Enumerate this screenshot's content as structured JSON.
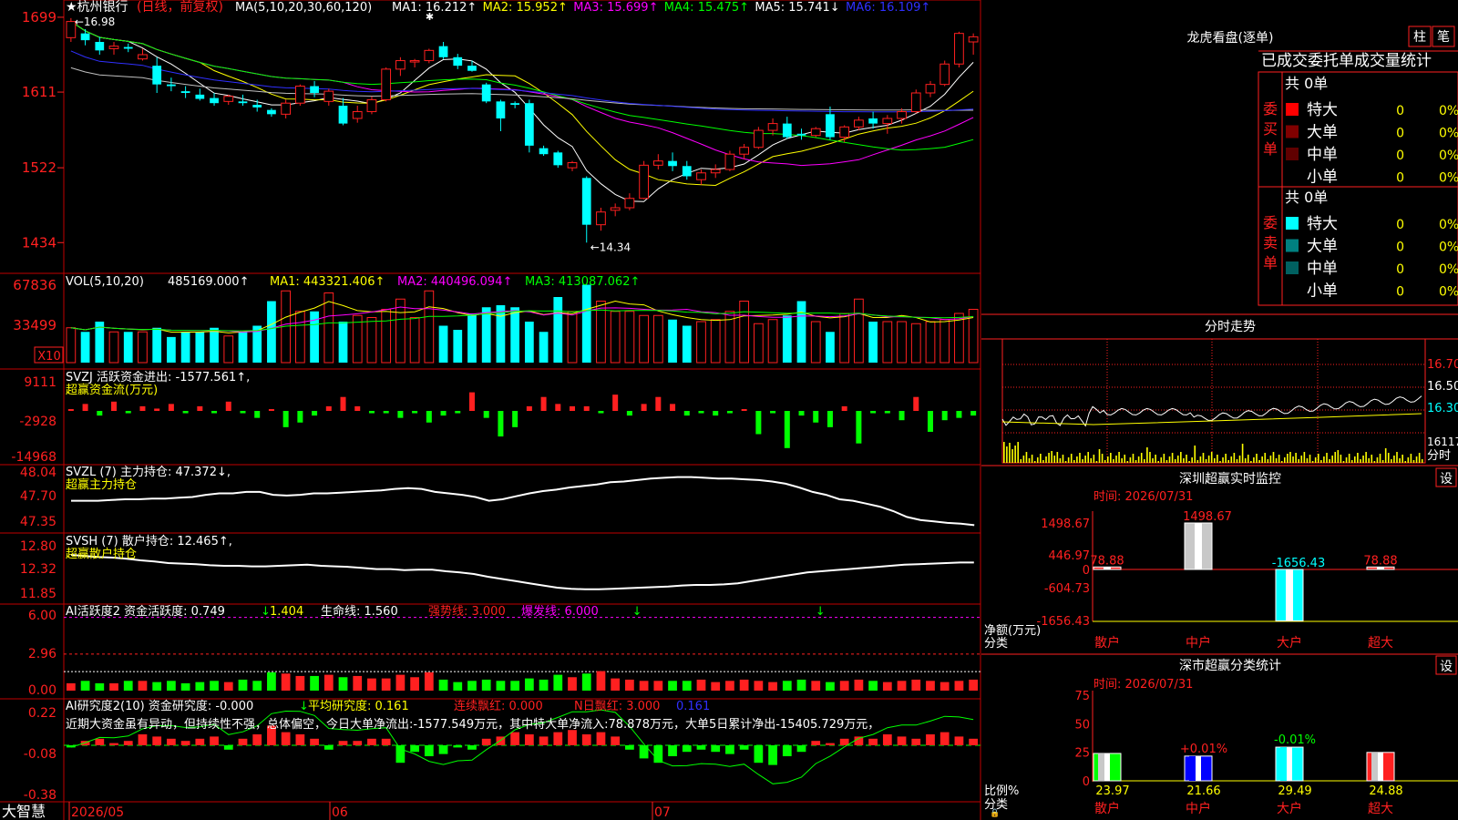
{
  "colors": {
    "up": "#ff2020",
    "down": "#00ffff",
    "border": "#c00000",
    "ma1": "#ffffff",
    "ma2": "#ffff00",
    "ma3": "#ff00ff",
    "ma4": "#00ff00",
    "ma5": "#c0c0c0",
    "ma6": "#3030ff",
    "green_bar": "#00ff00"
  },
  "title_bar": {
    "star": "★",
    "stock_name": "杭州银行",
    "period": "(日线，前复权)",
    "ma_params": "MA(5,10,20,30,60,120)",
    "ma_values": [
      {
        "label": "MA1: 16.212↑",
        "color": "#ffffff"
      },
      {
        "label": "MA2: 15.952↑",
        "color": "#ffff00"
      },
      {
        "label": "MA3: 15.699↑",
        "color": "#ff00ff"
      },
      {
        "label": "MA4: 15.475↑",
        "color": "#00ff00"
      },
      {
        "label": "MA5: 15.741↓",
        "color": "#ffffff"
      },
      {
        "label": "MA6: 16.109↑",
        "color": "#3030ff"
      }
    ]
  },
  "price_axis": [
    "1699",
    "1611",
    "1522",
    "1434"
  ],
  "high_label": "16.98",
  "low_label": "14.34",
  "candles": [
    [
      16.75,
      16.98,
      16.7,
      16.94
    ],
    [
      16.8,
      16.85,
      16.66,
      16.72
    ],
    [
      16.7,
      16.76,
      16.55,
      16.6
    ],
    [
      16.62,
      16.7,
      16.55,
      16.65
    ],
    [
      16.64,
      16.68,
      16.58,
      16.62
    ],
    [
      16.5,
      16.62,
      16.48,
      16.55
    ],
    [
      16.42,
      16.52,
      16.1,
      16.2
    ],
    [
      16.2,
      16.28,
      16.12,
      16.18
    ],
    [
      16.12,
      16.18,
      16.04,
      16.1
    ],
    [
      16.08,
      16.15,
      16.01,
      16.03
    ],
    [
      16.04,
      16.1,
      15.95,
      15.98
    ],
    [
      16.0,
      16.08,
      15.96,
      16.06
    ],
    [
      16.0,
      16.08,
      15.95,
      15.98
    ],
    [
      15.96,
      16.02,
      15.88,
      15.93
    ],
    [
      15.9,
      15.92,
      15.82,
      15.85
    ],
    [
      15.85,
      16.02,
      15.8,
      15.98
    ],
    [
      15.98,
      16.2,
      15.95,
      16.18
    ],
    [
      16.18,
      16.24,
      16.05,
      16.1
    ],
    [
      16.0,
      16.15,
      15.95,
      16.12
    ],
    [
      15.95,
      16.04,
      15.72,
      15.74
    ],
    [
      15.8,
      15.95,
      15.75,
      15.88
    ],
    [
      15.88,
      16.06,
      15.85,
      16.02
    ],
    [
      16.02,
      16.4,
      16.0,
      16.38
    ],
    [
      16.38,
      16.52,
      16.3,
      16.48
    ],
    [
      16.48,
      16.5,
      16.4,
      16.48
    ],
    [
      16.48,
      16.62,
      16.45,
      16.6
    ],
    [
      16.65,
      16.7,
      16.5,
      16.52
    ],
    [
      16.52,
      16.56,
      16.38,
      16.42
    ],
    [
      16.42,
      16.48,
      16.35,
      16.36
    ],
    [
      16.2,
      16.22,
      15.98,
      16.0
    ],
    [
      16.0,
      16.02,
      15.65,
      15.8
    ],
    [
      15.98,
      16.0,
      15.92,
      15.96
    ],
    [
      15.98,
      16.02,
      15.4,
      15.48
    ],
    [
      15.45,
      15.48,
      15.36,
      15.38
    ],
    [
      15.4,
      15.42,
      15.22,
      15.25
    ],
    [
      15.22,
      15.3,
      15.18,
      15.28
    ],
    [
      15.1,
      15.12,
      14.34,
      14.55
    ],
    [
      14.55,
      14.75,
      14.48,
      14.7
    ],
    [
      14.72,
      14.8,
      14.65,
      14.75
    ],
    [
      14.75,
      14.92,
      14.72,
      14.86
    ],
    [
      14.86,
      15.3,
      14.85,
      15.25
    ],
    [
      15.25,
      15.38,
      15.2,
      15.3
    ],
    [
      15.3,
      15.4,
      15.18,
      15.24
    ],
    [
      15.24,
      15.3,
      15.08,
      15.12
    ],
    [
      15.08,
      15.2,
      15.02,
      15.16
    ],
    [
      15.16,
      15.26,
      15.1,
      15.2
    ],
    [
      15.2,
      15.42,
      15.18,
      15.38
    ],
    [
      15.38,
      15.5,
      15.32,
      15.46
    ],
    [
      15.46,
      15.7,
      15.44,
      15.66
    ],
    [
      15.66,
      15.8,
      15.6,
      15.74
    ],
    [
      15.74,
      15.82,
      15.56,
      15.58
    ],
    [
      15.62,
      15.68,
      15.55,
      15.6
    ],
    [
      15.6,
      15.7,
      15.58,
      15.68
    ],
    [
      15.85,
      15.94,
      15.55,
      15.58
    ],
    [
      15.58,
      15.72,
      15.52,
      15.7
    ],
    [
      15.7,
      15.82,
      15.66,
      15.78
    ],
    [
      15.8,
      15.88,
      15.68,
      15.74
    ],
    [
      15.74,
      15.84,
      15.62,
      15.8
    ],
    [
      15.8,
      15.92,
      15.74,
      15.88
    ],
    [
      15.88,
      16.14,
      15.86,
      16.1
    ],
    [
      16.1,
      16.24,
      16.05,
      16.2
    ],
    [
      16.2,
      16.48,
      16.18,
      16.44
    ],
    [
      16.44,
      16.82,
      16.4,
      16.8
    ],
    [
      16.7,
      16.8,
      16.55,
      16.76
    ]
  ],
  "vol_panel": {
    "params": "VOL(5,10,20)",
    "value": "485169.000↑",
    "ma1": "MA1: 443321.406↑",
    "ma2": "MA2: 440496.094↑",
    "ma3": "MA3: 413087.062↑",
    "axis": [
      "67836",
      "33499"
    ],
    "unit": "X10",
    "bars": [
      34,
      30,
      40,
      30,
      30,
      30,
      34,
      25,
      30,
      30,
      34,
      26,
      30,
      36,
      60,
      70,
      50,
      50,
      68,
      40,
      46,
      44,
      52,
      62,
      44,
      70,
      36,
      32,
      48,
      54,
      56,
      54,
      40,
      30,
      64,
      50,
      76,
      60,
      50,
      50,
      46,
      46,
      42,
      36,
      40,
      42,
      50,
      60,
      38,
      42,
      46,
      60,
      40,
      30,
      48,
      62,
      40,
      40,
      40,
      38,
      40,
      42,
      48,
      52
    ]
  },
  "svzj_panel": {
    "title": "SVZJ  活跃资金进出: -1577.561↑,",
    "subtitle": "超赢资金流(万元)",
    "axis": [
      "9111",
      "-2928",
      "-14968"
    ],
    "bars": [
      0,
      3,
      -2,
      4,
      -1,
      2,
      1,
      3,
      -1,
      2,
      -1,
      4,
      -1,
      -3,
      0,
      -7,
      -5,
      -2,
      2,
      6,
      2,
      -1,
      -1,
      -3,
      -1,
      -5,
      -2,
      -1,
      8,
      -3,
      -11,
      -7,
      2,
      6,
      3,
      2,
      2,
      -1,
      7,
      -2,
      3,
      6,
      3,
      -2,
      -1,
      -2,
      -1,
      0,
      -10,
      -1,
      -16,
      -2,
      -5,
      -7,
      2,
      -14,
      -1,
      -1,
      -4,
      6,
      -9,
      -4,
      -3,
      -2
    ]
  },
  "svzl_panel": {
    "title": "SVZL (7) 主力持仓: 47.372↓,",
    "subtitle": "超赢主力持仓",
    "axis": [
      "48.04",
      "47.70",
      "47.35"
    ],
    "line": [
      47.7,
      47.7,
      47.7,
      47.71,
      47.72,
      47.72,
      47.73,
      47.73,
      47.74,
      47.75,
      47.78,
      47.8,
      47.8,
      47.82,
      47.82,
      47.78,
      47.77,
      47.78,
      47.8,
      47.8,
      47.81,
      47.82,
      47.83,
      47.84,
      47.86,
      47.87,
      47.86,
      47.82,
      47.8,
      47.78,
      47.75,
      47.7,
      47.72,
      47.76,
      47.8,
      47.83,
      47.85,
      47.88,
      47.9,
      47.92,
      47.95,
      47.96,
      47.98,
      48.0,
      48.01,
      48.02,
      48.02,
      48.01,
      48.0,
      48.0,
      47.99,
      47.98,
      47.96,
      47.93,
      47.88,
      47.82,
      47.78,
      47.72,
      47.7,
      47.66,
      47.62,
      47.56,
      47.48,
      47.44,
      47.42,
      47.4,
      47.39,
      47.37
    ]
  },
  "svsh_panel": {
    "title": "SVSH (7) 散户持仓: 12.465↑,",
    "subtitle": "超赢散户持仓",
    "axis": [
      "12.80",
      "12.32",
      "11.85"
    ],
    "line": [
      12.6,
      12.58,
      12.56,
      12.55,
      12.53,
      12.5,
      12.48,
      12.45,
      12.44,
      12.43,
      12.41,
      12.4,
      12.4,
      12.39,
      12.39,
      12.4,
      12.41,
      12.42,
      12.4,
      12.39,
      12.38,
      12.36,
      12.34,
      12.34,
      12.32,
      12.33,
      12.33,
      12.3,
      12.28,
      12.25,
      12.2,
      12.16,
      12.12,
      12.08,
      12.04,
      12.0,
      11.98,
      11.97,
      11.97,
      11.98,
      11.99,
      12.0,
      12.01,
      12.02,
      12.04,
      12.05,
      12.05,
      12.06,
      12.08,
      12.12,
      12.16,
      12.2,
      12.24,
      12.28,
      12.3,
      12.32,
      12.34,
      12.36,
      12.38,
      12.4,
      12.42,
      12.43,
      12.44,
      12.45,
      12.46,
      12.46
    ]
  },
  "ai_active_panel": {
    "title": "AI活跃度2 资金活跃度: 0.749",
    "arrow1": "↓",
    "v2": "1.404",
    "life": "生命线: 1.560",
    "strong": "强势线: 3.000",
    "burst": "爆发线: 6.000",
    "axis": [
      "6.00",
      "2.96",
      "0.00"
    ],
    "bars": [
      0.6,
      0.8,
      0.6,
      0.6,
      0.8,
      0.8,
      0.7,
      0.8,
      0.6,
      0.7,
      0.8,
      0.7,
      0.9,
      0.8,
      1.5,
      1.4,
      1.2,
      1.2,
      1.3,
      1.1,
      1.2,
      1.0,
      1.0,
      1.3,
      1.1,
      1.5,
      0.9,
      0.7,
      0.8,
      0.9,
      0.8,
      0.8,
      1.0,
      0.9,
      1.3,
      1.1,
      1.4,
      1.6,
      1.0,
      0.9,
      0.8,
      0.8,
      0.8,
      0.8,
      0.9,
      0.7,
      0.8,
      0.9,
      0.8,
      0.7,
      0.8,
      0.9,
      0.8,
      0.7,
      0.8,
      0.9,
      0.8,
      0.7,
      0.8,
      0.9,
      0.8,
      0.7,
      0.8,
      0.9
    ]
  },
  "ai_research_panel": {
    "title": "AI研究度2(10) 资金研究度: -0.000",
    "arrow1": "↓",
    "avg": "平均研究度: 0.161",
    "cont": "连续飘红: 0.000",
    "nday": "N日飘红: 3.000",
    "last": "0.161",
    "axis": [
      "0.22",
      "-0.08",
      "-0.38"
    ],
    "comment": "近期大资金虽有异动，但持续性不强，总体偏空，今日大单净流出:-1577.549万元，其中特大单净流入:78.878万元，大单5日累计净出-15405.729万元，",
    "bars": [
      -0.01,
      0.02,
      0.03,
      0.01,
      0.02,
      0.05,
      0.04,
      0.03,
      0.02,
      0.03,
      0.04,
      -0.02,
      0.03,
      0.05,
      0.09,
      0.06,
      0.05,
      0.03,
      -0.02,
      0.02,
      0.02,
      0.03,
      0.03,
      -0.08,
      -0.03,
      -0.05,
      -0.04,
      -0.01,
      -0.02,
      0.03,
      0.04,
      0.06,
      0.05,
      0.04,
      0.06,
      0.07,
      0.05,
      0.06,
      0.04,
      -0.02,
      -0.06,
      -0.08,
      -0.05,
      -0.03,
      -0.02,
      -0.03,
      -0.04,
      -0.02,
      -0.08,
      -0.09,
      -0.05,
      -0.03,
      0.02,
      0.01,
      0.03,
      0.04,
      0.03,
      0.05,
      0.04,
      0.03,
      0.05,
      0.06,
      0.04,
      0.03
    ]
  },
  "x_axis": {
    "brand": "大智慧",
    "labels": [
      "2026/05",
      "06",
      "07"
    ]
  },
  "dragon_tiger": {
    "title": "龙虎看盘(逐单)",
    "btn1": "柱",
    "btn2": "笔",
    "tabs": "已成交委托单成交量统计",
    "buy_side": "委买单",
    "sell_side": "委卖单",
    "buy_total": "共 0单",
    "sell_total": "共 0单",
    "rows": [
      {
        "label": "特大",
        "count": "0",
        "pct": "0%"
      },
      {
        "label": "大单",
        "count": "0",
        "pct": "0%"
      },
      {
        "label": "中单",
        "count": "0",
        "pct": "0%"
      },
      {
        "label": "小单",
        "count": "0",
        "pct": "0%"
      }
    ],
    "buy_colors": [
      "#ff0000",
      "#800000",
      "#600000",
      "#000000"
    ],
    "sell_colors": [
      "#00ffff",
      "#008080",
      "#006060",
      "#000000"
    ]
  },
  "intraday": {
    "title": "分时走势",
    "axis": [
      "16.70",
      "16.50",
      "16.30",
      "16117"
    ],
    "unit": "分时"
  },
  "monitor": {
    "title": "深圳超赢实时监控",
    "set": "设",
    "time": "时间: 2026/07/31",
    "axis": [
      "1498.67",
      "446.97",
      "0",
      "-604.73",
      "-1656.43"
    ],
    "ylabel": "净额(万元)",
    "xlabel": "分类",
    "categories": [
      "散户",
      "中户",
      "大户",
      "超大"
    ],
    "values": [
      78.88,
      1498.67,
      -1656.43,
      78.88
    ],
    "value_labels": [
      "78.88",
      "1498.67",
      "-1656.43",
      "78.88"
    ]
  },
  "classify": {
    "title": "深市超赢分类统计",
    "set": "设",
    "time": "时间: 2026/07/31",
    "axis": [
      "75",
      "50",
      "25",
      "0"
    ],
    "ylabel": "比例%",
    "xlabel": "分类",
    "categories": [
      "散户",
      "中户",
      "大户",
      "超大"
    ],
    "values": [
      23.97,
      21.66,
      29.49,
      24.88
    ],
    "value_labels": [
      "23.97",
      "21.66",
      "29.49",
      "24.88"
    ],
    "deltas": [
      "",
      "+0.01%",
      "-0.01%",
      ""
    ]
  }
}
